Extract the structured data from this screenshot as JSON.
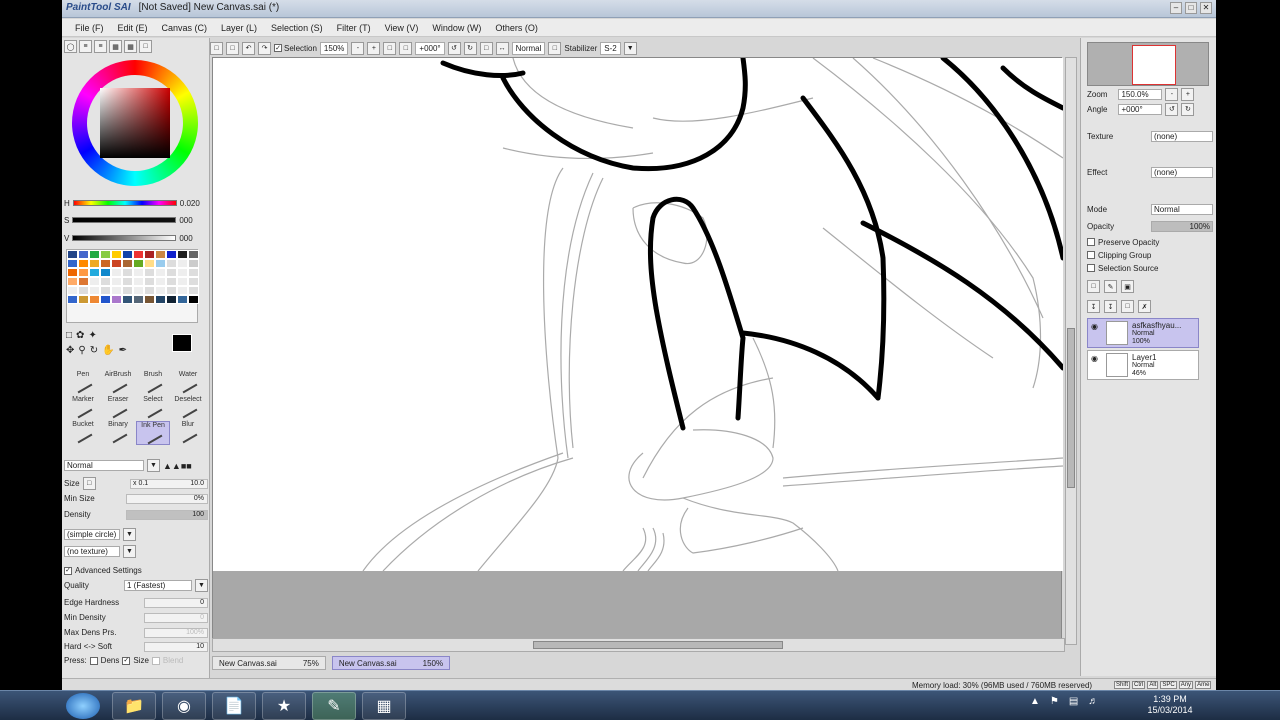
{
  "window": {
    "app_logo": "PaintTool SAI",
    "title": "[Not Saved] New Canvas.sai (*)",
    "controls": [
      "minimize",
      "maximize",
      "close"
    ]
  },
  "menu": [
    "File (F)",
    "Edit (E)",
    "Canvas (C)",
    "Layer (L)",
    "Selection (S)",
    "Filter (T)",
    "View (V)",
    "Window (W)",
    "Others (O)"
  ],
  "toolbar": {
    "selection_label": "Selection",
    "zoom": "150%",
    "rotation": "+000°",
    "blend_mode": "Normal",
    "stabilizer_label": "Stabilizer",
    "stabilizer_value": "S-2"
  },
  "color": {
    "h_label": "H",
    "h_value": "0.020",
    "s_label": "S",
    "s_value": "000",
    "v_label": "V",
    "v_value": "000",
    "palette": [
      "#224488",
      "#4466cc",
      "#22aa44",
      "#88cc44",
      "#ffcc00",
      "#1144aa",
      "#ee3333",
      "#aa2222",
      "#cc8844",
      "#1122cc",
      "#222222",
      "#666666",
      "#3366cc",
      "#ff8800",
      "#eeaa22",
      "#cc6622",
      "#cc4422",
      "#aa6633",
      "#66aa22",
      "#ffdd88",
      "#99ccee",
      "#dddddd",
      "#eeeeee",
      "#cccccc",
      "#ee6600",
      "#ff9944",
      "#22aadd",
      "#1188cc",
      "#eeeeee",
      "#dddddd",
      "#eeeeee",
      "#dddddd",
      "#eeeeee",
      "#dddddd",
      "#eeeeee",
      "#dddddd",
      "#ffaa66",
      "#dd7733",
      "#eeeeee",
      "#dddddd",
      "#eeeeee",
      "#dddddd",
      "#eeeeee",
      "#dddddd",
      "#eeeeee",
      "#dddddd",
      "#eeeeee",
      "#dddddd",
      "#eeeeee",
      "#dddddd",
      "#eeeeee",
      "#dddddd",
      "#eeeeee",
      "#dddddd",
      "#eeeeee",
      "#dddddd",
      "#eeeeee",
      "#dddddd",
      "#eeeeee",
      "#dddddd",
      "#3366cc",
      "#cc9933",
      "#ee8833",
      "#2255cc",
      "#aa77cc",
      "#335577",
      "#556677",
      "#775533",
      "#224466",
      "#112233",
      "#336699",
      "#000000"
    ]
  },
  "brushes": [
    {
      "label": "Pen"
    },
    {
      "label": "AirBrush"
    },
    {
      "label": "Brush"
    },
    {
      "label": "Water"
    },
    {
      "label": "Marker"
    },
    {
      "label": "Eraser"
    },
    {
      "label": "Select"
    },
    {
      "label": "Deselect"
    },
    {
      "label": "Bucket"
    },
    {
      "label": "Binary"
    },
    {
      "label": "Ink Pen",
      "selected": true
    },
    {
      "label": "Blur"
    }
  ],
  "brush_props": {
    "mode": "Normal",
    "size_label": "Size",
    "size_mult": "x 0.1",
    "size_value": "10.0",
    "min_size_label": "Min Size",
    "min_size_value": "0%",
    "density_label": "Density",
    "density_value": "100",
    "shape": "(simple circle)",
    "texture": "(no texture)",
    "advanced_label": "Advanced Settings",
    "quality_label": "Quality",
    "quality_value": "1 (Fastest)",
    "edge_label": "Edge Hardness",
    "edge_value": "0",
    "min_density_label": "Min Density",
    "min_density_value": "0",
    "max_dens_label": "Max Dens Prs.",
    "max_dens_value": "100%",
    "hard_soft_label": "Hard <-> Soft",
    "hard_soft_value": "10",
    "press_label": "Press:",
    "dens_label": "Dens",
    "size_chk_label": "Size",
    "blend_chk_label": "Blend"
  },
  "navigator": {
    "zoom_label": "Zoom",
    "zoom_value": "150.0%",
    "angle_label": "Angle",
    "angle_value": "+000°"
  },
  "layer_props": {
    "texture_label": "Texture",
    "texture_value": "(none)",
    "effect_label": "Effect",
    "effect_value": "(none)",
    "mode_label": "Mode",
    "mode_value": "Normal",
    "opacity_label": "Opacity",
    "opacity_value": "100%",
    "preserve_opacity": "Preserve Opacity",
    "clipping_group": "Clipping Group",
    "selection_source": "Selection Source"
  },
  "layers": [
    {
      "name": "asfkasfhyau...",
      "mode": "Normal",
      "opacity": "100%",
      "active": true
    },
    {
      "name": "Layer1",
      "mode": "Normal",
      "opacity": "46%",
      "active": false
    }
  ],
  "canvas_tabs": [
    {
      "name": "New Canvas.sai",
      "zoom": "75%",
      "active": false
    },
    {
      "name": "New Canvas.sai",
      "zoom": "150%",
      "active": true
    }
  ],
  "status": {
    "memory": "Memory load: 30% (96MB used / 760MB reserved)",
    "icons": [
      "Shift",
      "Ctrl",
      "Alt",
      "SPC",
      "Any",
      "Ame"
    ]
  },
  "taskbar": {
    "time": "1:39 PM",
    "date": "15/03/2014"
  }
}
